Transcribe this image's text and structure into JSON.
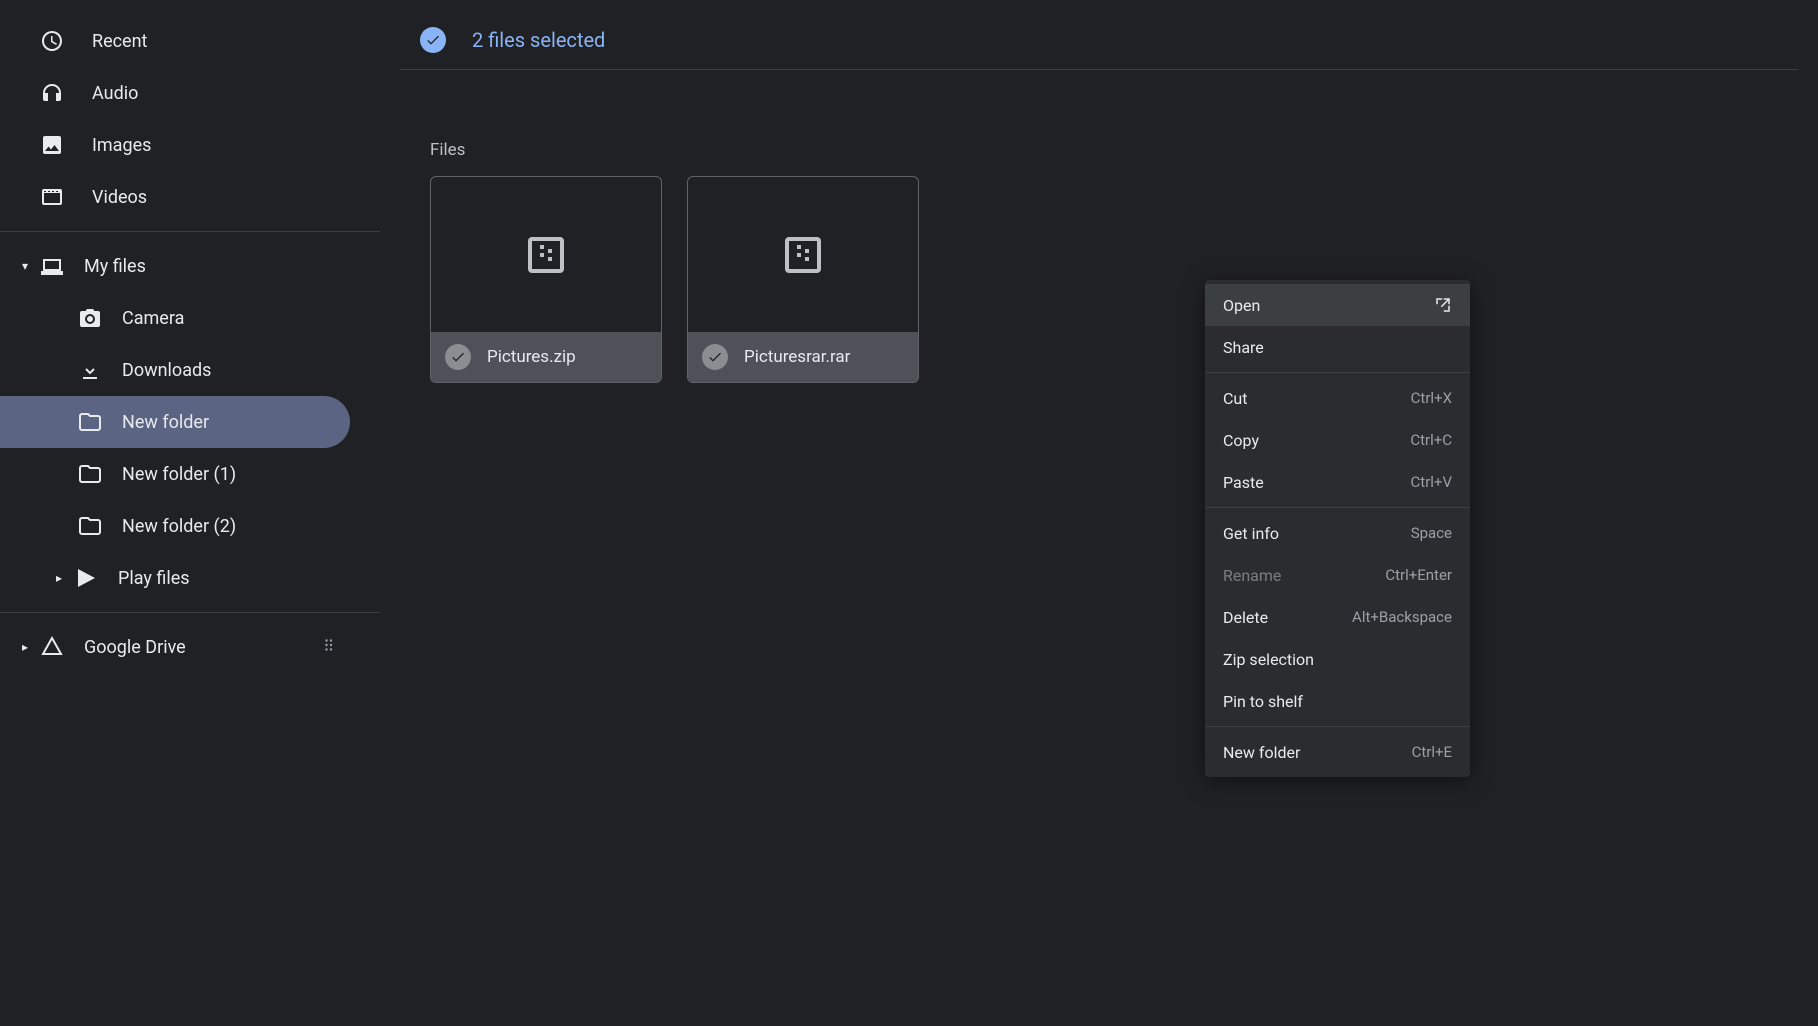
{
  "sidebar": {
    "quick": [
      {
        "icon": "clock",
        "label": "Recent"
      },
      {
        "icon": "headphones",
        "label": "Audio"
      },
      {
        "icon": "image",
        "label": "Images"
      },
      {
        "icon": "video",
        "label": "Videos"
      }
    ],
    "myfiles": {
      "label": "My files",
      "children": [
        {
          "icon": "camera",
          "label": "Camera"
        },
        {
          "icon": "download",
          "label": "Downloads"
        },
        {
          "icon": "folder",
          "label": "New folder",
          "selected": true
        },
        {
          "icon": "folder",
          "label": "New folder (1)"
        },
        {
          "icon": "folder",
          "label": "New folder (2)"
        },
        {
          "icon": "play",
          "label": "Play files",
          "has_children": true
        }
      ]
    },
    "drive_label": "Google Drive"
  },
  "header": {
    "selection_label": "2 files selected"
  },
  "content": {
    "section_title": "Files",
    "files": [
      {
        "name": "Pictures.zip",
        "selected": true
      },
      {
        "name": "Picturesrar.rar",
        "selected": true
      }
    ]
  },
  "context_menu": {
    "items": [
      {
        "label": "Open",
        "trail_icon": true,
        "highlight": true
      },
      {
        "label": "Share"
      },
      {
        "sep": true
      },
      {
        "label": "Cut",
        "shortcut": "Ctrl+X"
      },
      {
        "label": "Copy",
        "shortcut": "Ctrl+C"
      },
      {
        "label": "Paste",
        "shortcut": "Ctrl+V"
      },
      {
        "sep": true
      },
      {
        "label": "Get info",
        "shortcut": "Space"
      },
      {
        "label": "Rename",
        "shortcut": "Ctrl+Enter",
        "disabled": true
      },
      {
        "label": "Delete",
        "shortcut": "Alt+Backspace"
      },
      {
        "label": "Zip selection"
      },
      {
        "label": "Pin to shelf"
      },
      {
        "sep": true
      },
      {
        "label": "New folder",
        "shortcut": "Ctrl+E"
      }
    ]
  }
}
